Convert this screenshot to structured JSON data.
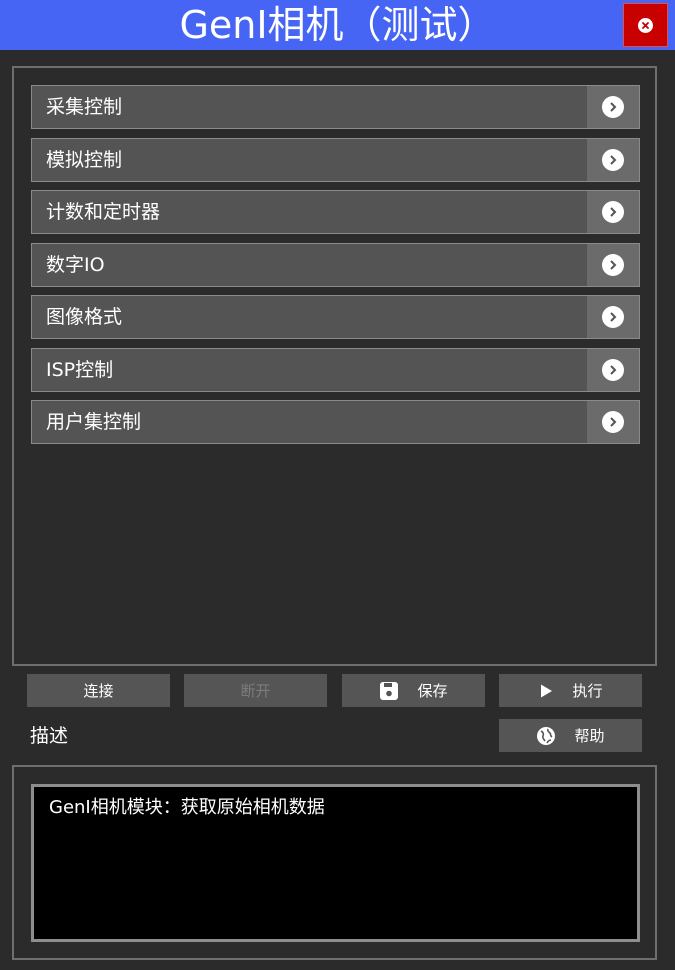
{
  "window": {
    "title": "GenI相机（测试）"
  },
  "colors": {
    "titlebar": "#4665f5",
    "close_button": "#c80000",
    "background": "#2b2b2b",
    "menu_item": "#545454",
    "button": "#555555"
  },
  "menu": {
    "items": [
      {
        "label": "采集控制"
      },
      {
        "label": "模拟控制"
      },
      {
        "label": "计数和定时器"
      },
      {
        "label": "数字IO"
      },
      {
        "label": "图像格式"
      },
      {
        "label": "ISP控制"
      },
      {
        "label": "用户集控制"
      }
    ]
  },
  "toolbar": {
    "connect_label": "连接",
    "disconnect_label": "断开",
    "save_label": "保存",
    "execute_label": "执行",
    "help_label": "帮助"
  },
  "description": {
    "label": "描述",
    "text": "GenI相机模块：获取原始相机数据"
  }
}
